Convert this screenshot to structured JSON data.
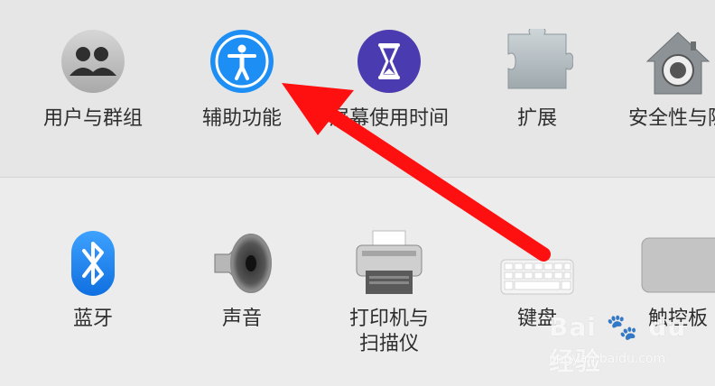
{
  "preferences": {
    "row1": [
      {
        "label": "用户与群组",
        "icon": "users-group-icon"
      },
      {
        "label": "辅助功能",
        "icon": "accessibility-icon"
      },
      {
        "label": "屏幕使用时间",
        "icon": "hourglass-icon"
      },
      {
        "label": "扩展",
        "icon": "puzzle-icon"
      },
      {
        "label": "安全性与隐",
        "icon": "house-lock-icon"
      }
    ],
    "row2": [
      {
        "label": "蓝牙",
        "icon": "bluetooth-icon"
      },
      {
        "label": "声音",
        "icon": "speaker-icon"
      },
      {
        "label": "打印机与\n扫描仪",
        "icon": "printer-icon"
      },
      {
        "label": "键盘",
        "icon": "keyboard-icon"
      },
      {
        "label": "触控板",
        "icon": "trackpad-icon"
      }
    ]
  },
  "colors": {
    "accent_blue": "#1d8ff4",
    "screen_time_purple": "#4a3cb0",
    "arrow_red": "#ff1010"
  },
  "watermark": {
    "brand": "Bai",
    "brand2": "du",
    "suffix": "经验",
    "domain": "jingyan.baidu.com"
  }
}
